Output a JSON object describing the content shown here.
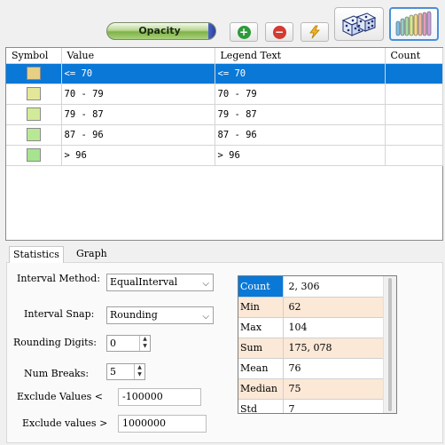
{
  "toolbar": {
    "opacity_label": "Opacity",
    "add_icon": "plus-circle-icon",
    "remove_icon": "minus-circle-icon",
    "lightning_icon": "lightning-icon",
    "dice_icon": "dice-icon",
    "ramp_icon": "color-ramp-icon"
  },
  "grid": {
    "columns": [
      "Symbol",
      "Value",
      "Legend Text",
      "Count"
    ],
    "rows": [
      {
        "color": "#e8cf86",
        "value": "<= 70",
        "legend": "<= 70",
        "count": ""
      },
      {
        "color": "#e4e79a",
        "value": "70 - 79",
        "legend": "70 - 79",
        "count": ""
      },
      {
        "color": "#d2eb98",
        "value": "79 - 87",
        "legend": "79 - 87",
        "count": ""
      },
      {
        "color": "#b9e894",
        "value": "87 - 96",
        "legend": "87 - 96",
        "count": ""
      },
      {
        "color": "#a6e490",
        "value": "> 96",
        "legend": "> 96",
        "count": ""
      }
    ]
  },
  "tabs": [
    "Statistics",
    "Graph"
  ],
  "form": {
    "interval_method_label": "Interval Method:",
    "interval_method_value": "EqualInterval",
    "interval_snap_label": "Interval Snap:",
    "interval_snap_value": "Rounding",
    "rounding_digits_label": "Rounding Digits:",
    "rounding_digits_value": "0",
    "num_breaks_label": "Num Breaks:",
    "num_breaks_value": "5",
    "exclude_lt_label": "Exclude Values <",
    "exclude_lt_value": "-100000",
    "exclude_gt_label": "Exclude values >",
    "exclude_gt_value": "1000000"
  },
  "stats": [
    {
      "key": "Count",
      "value": "2, 306"
    },
    {
      "key": "Min",
      "value": "62"
    },
    {
      "key": "Max",
      "value": "104"
    },
    {
      "key": "Sum",
      "value": "175, 078"
    },
    {
      "key": "Mean",
      "value": "76"
    },
    {
      "key": "Median",
      "value": "75"
    },
    {
      "key": "Std",
      "value": "7"
    }
  ],
  "colors": {
    "selection": "#0a78d7",
    "stats_alt_row": "#fbe8d6",
    "add_green": "#2e9a3a",
    "remove_red": "#d23a32",
    "lightning_yellow": "#f2b51a"
  }
}
